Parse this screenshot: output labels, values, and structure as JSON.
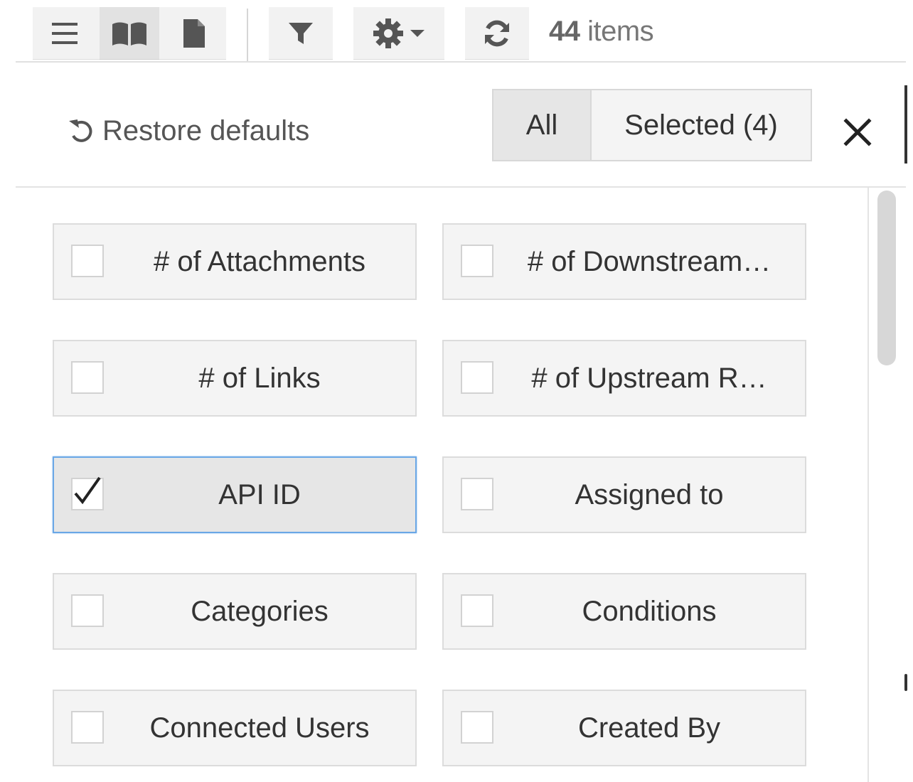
{
  "toolbar": {
    "view_buttons": [
      {
        "icon": "list-icon",
        "active": false
      },
      {
        "icon": "book-icon",
        "active": true
      },
      {
        "icon": "document-icon",
        "active": false
      }
    ],
    "filter_icon": "filter-icon",
    "settings_icon": "gear-icon",
    "dropdown_icon": "caret-down-icon",
    "refresh_icon": "refresh-icon",
    "items_count": "44",
    "items_label": " items"
  },
  "panel": {
    "restore_label": "Restore defaults",
    "restore_icon": "undo-icon",
    "filter_all_label": "All",
    "filter_selected_label": "Selected (4)",
    "close_icon": "close-icon",
    "fields": [
      {
        "label": "# of Attachments",
        "checked": false
      },
      {
        "label": "# of Downstream…",
        "checked": false
      },
      {
        "label": "# of Links",
        "checked": false
      },
      {
        "label": "# of Upstream R…",
        "checked": false
      },
      {
        "label": "API ID",
        "checked": true
      },
      {
        "label": "Assigned to",
        "checked": false
      },
      {
        "label": "Categories",
        "checked": false
      },
      {
        "label": "Conditions",
        "checked": false
      },
      {
        "label": "Connected Users",
        "checked": false
      },
      {
        "label": "Created By",
        "checked": false
      }
    ]
  },
  "colors": {
    "accent_border": "#6aa7e6",
    "button_bg": "#f4f4f4",
    "active_bg": "#e6e6e6"
  }
}
